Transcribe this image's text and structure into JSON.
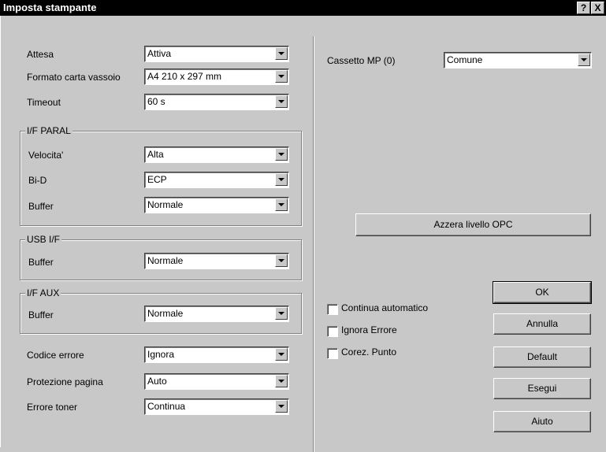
{
  "window": {
    "title": "Imposta stampante",
    "help_glyph": "?",
    "close_glyph": "X"
  },
  "fields": {
    "attesa": {
      "label": "Attesa",
      "value": "Attiva"
    },
    "formato": {
      "label": "Formato carta vassoio",
      "value": "A4 210 x 297 mm"
    },
    "timeout": {
      "label": "Timeout",
      "value": "60 s"
    },
    "codice_errore": {
      "label": "Codice errore",
      "value": "Ignora"
    },
    "protezione": {
      "label": "Protezione pagina",
      "value": "Auto"
    },
    "errore_toner": {
      "label": "Errore toner",
      "value": "Continua"
    },
    "cassetto_mp": {
      "label": "Cassetto MP (0)",
      "value": "Comune"
    }
  },
  "groups": {
    "if_paral": {
      "title": "I/F PARAL",
      "velocita": {
        "label": "Velocita'",
        "value": "Alta"
      },
      "bid": {
        "label": "Bi-D",
        "value": "ECP"
      },
      "buffer": {
        "label": "Buffer",
        "value": "Normale"
      }
    },
    "usb_if": {
      "title": "USB I/F",
      "buffer": {
        "label": "Buffer",
        "value": "Normale"
      }
    },
    "if_aux": {
      "title": "I/F AUX",
      "buffer": {
        "label": "Buffer",
        "value": "Normale"
      }
    }
  },
  "buttons": {
    "azzera_opc": "Azzera livello OPC",
    "ok": "OK",
    "annulla": "Annulla",
    "default": "Default",
    "esegui": "Esegui",
    "aiuto": "Aiuto"
  },
  "checkboxes": {
    "continua_auto": "Continua automatico",
    "ignora_errore": "Ignora Errore",
    "corez_punto": "Corez. Punto"
  }
}
